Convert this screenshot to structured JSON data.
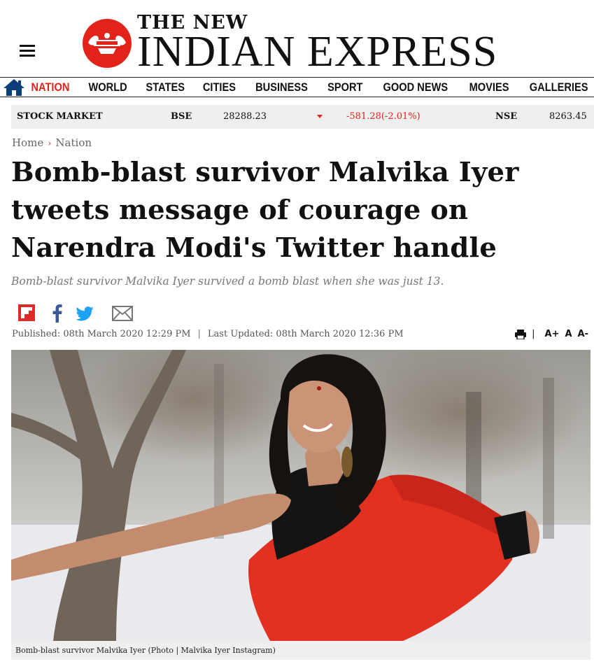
{
  "header": {
    "logo_small": "THE NEW",
    "logo_big": "INDIAN EXPRESS",
    "brand_color": "#e2231a"
  },
  "nav": {
    "items": [
      {
        "label": "NATION",
        "active": true
      },
      {
        "label": "WORLD"
      },
      {
        "label": "STATES"
      },
      {
        "label": "CITIES"
      },
      {
        "label": "BUSINESS"
      },
      {
        "label": "SPORT"
      },
      {
        "label": "GOOD NEWS"
      },
      {
        "label": "MOVIES"
      },
      {
        "label": "GALLERIES"
      }
    ]
  },
  "stock": {
    "label": "STOCK MARKET",
    "bse_label": "BSE",
    "bse_value": "28288.23",
    "bse_change": "-581.28(-2.01%)",
    "nse_label": "NSE",
    "nse_value": "8263.45"
  },
  "breadcrumb": {
    "home": "Home",
    "section": "Nation"
  },
  "article": {
    "headline": "Bomb-blast survivor Malvika Iyer tweets message of courage on Narendra Modi's Twitter handle",
    "subhead": "Bomb-blast survivor Malvika Iyer survived a bomb blast when she was just 13.",
    "published": "Published: 08th March 2020 12:29 PM",
    "separator": "|",
    "updated": "Last Updated: 08th March 2020 12:36 PM",
    "caption": "Bomb-blast survivor Malvika Iyer (Photo | Malvika Iyer Instagram)"
  },
  "tools": {
    "sep": "|",
    "font_increase": "A+",
    "font_normal": "A",
    "font_decrease": "A-"
  },
  "share": [
    "flipboard-icon",
    "facebook-icon",
    "twitter-icon",
    "email-icon"
  ]
}
